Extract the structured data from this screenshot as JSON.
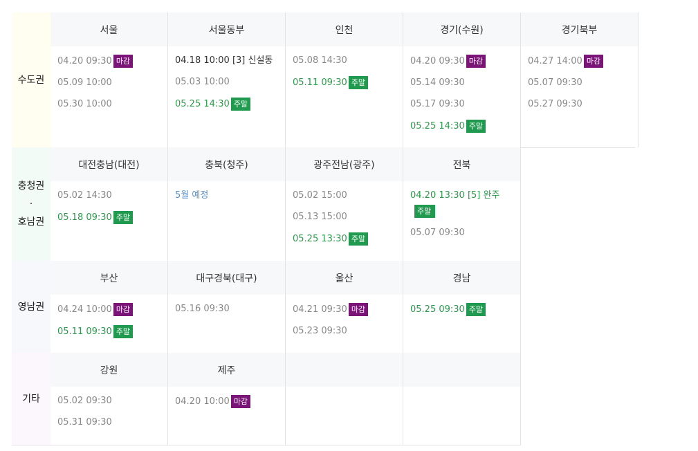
{
  "top_strip_text": "",
  "colors": {
    "closed_badge": "#7a1577",
    "weekend_badge": "#1f9a4e",
    "weekend_text": "#2a9a4a",
    "plan_text": "#5b8fc9",
    "capital_bg": "#fffef0",
    "chungho_bg": "#f3fbf6",
    "yeongnam_bg": "#f6f8fc",
    "other_bg": "#fbf7fd"
  },
  "regions": [
    {
      "label_lines": [
        "수도권"
      ],
      "cities": [
        {
          "name": "서울",
          "schedules": [
            {
              "text": "04.20 09:30",
              "status": "closed",
              "badge": "마감"
            },
            {
              "text": "05.09 10:00",
              "status": "normal"
            },
            {
              "text": "05.30 10:00",
              "status": "normal"
            }
          ]
        },
        {
          "name": "서울동부",
          "schedules": [
            {
              "text": "04.18 10:00 [3] 신설동",
              "status": "dark"
            },
            {
              "text": "05.03 10:00",
              "status": "normal"
            },
            {
              "text": "05.25 14:30",
              "status": "weekend",
              "badge": "주말"
            }
          ]
        },
        {
          "name": "인천",
          "schedules": [
            {
              "text": "05.08 14:30",
              "status": "normal"
            },
            {
              "text": "05.11 09:30",
              "status": "weekend",
              "badge": "주말"
            }
          ]
        },
        {
          "name": "경기(수원)",
          "schedules": [
            {
              "text": "04.20 09:30",
              "status": "closed",
              "badge": "마감"
            },
            {
              "text": "05.14 09:30",
              "status": "normal"
            },
            {
              "text": "05.17 09:30",
              "status": "normal"
            },
            {
              "text": "05.25 14:30",
              "status": "weekend",
              "badge": "주말"
            }
          ]
        },
        {
          "name": "경기북부",
          "schedules": [
            {
              "text": "04.27 14:00",
              "status": "closed",
              "badge": "마감"
            },
            {
              "text": "05.07 09:30",
              "status": "normal"
            },
            {
              "text": "05.27 09:30",
              "status": "normal"
            }
          ]
        }
      ]
    },
    {
      "label_lines": [
        "충청권",
        "·",
        "호남권"
      ],
      "cities": [
        {
          "name": "대전충남(대전)",
          "schedules": [
            {
              "text": "05.02 14:30",
              "status": "normal"
            },
            {
              "text": "05.18 09:30",
              "status": "weekend",
              "badge": "주말"
            }
          ]
        },
        {
          "name": "충북(청주)",
          "schedules": [
            {
              "text": "5월 예정",
              "status": "plan"
            }
          ]
        },
        {
          "name": "광주전남(광주)",
          "schedules": [
            {
              "text": "05.02 15:00",
              "status": "normal"
            },
            {
              "text": "05.13 15:00",
              "status": "normal"
            },
            {
              "text": "05.25 13:30",
              "status": "weekend",
              "badge": "주말"
            }
          ]
        },
        {
          "name": "전북",
          "schedules": [
            {
              "text": "04.20 13:30 [5] 완주",
              "status": "weekend",
              "badge": "주말",
              "badge_below": true
            },
            {
              "text": "05.07 09:30",
              "status": "normal"
            }
          ]
        }
      ]
    },
    {
      "label_lines": [
        "영남권"
      ],
      "cities": [
        {
          "name": "부산",
          "schedules": [
            {
              "text": "04.24 10:00",
              "status": "closed",
              "badge": "마감"
            },
            {
              "text": "05.11 09:30",
              "status": "weekend",
              "badge": "주말"
            }
          ]
        },
        {
          "name": "대구경북(대구)",
          "schedules": [
            {
              "text": "05.16 09:30",
              "status": "normal"
            }
          ]
        },
        {
          "name": "울산",
          "schedules": [
            {
              "text": "04.21 09:30",
              "status": "closed",
              "badge": "마감"
            },
            {
              "text": "05.23 09:30",
              "status": "normal"
            }
          ]
        },
        {
          "name": "경남",
          "schedules": [
            {
              "text": "05.25 09:30",
              "status": "weekend",
              "badge": "주말"
            }
          ]
        }
      ]
    },
    {
      "label_lines": [
        "기타"
      ],
      "cities": [
        {
          "name": "강원",
          "schedules": [
            {
              "text": "05.02 09:30",
              "status": "normal"
            },
            {
              "text": "05.31 09:30",
              "status": "normal"
            }
          ]
        },
        {
          "name": "제주",
          "schedules": [
            {
              "text": "04.20 10:00",
              "status": "closed",
              "badge": "마감"
            }
          ]
        },
        {
          "name": "",
          "schedules": []
        },
        {
          "name": "",
          "schedules": []
        }
      ]
    }
  ]
}
